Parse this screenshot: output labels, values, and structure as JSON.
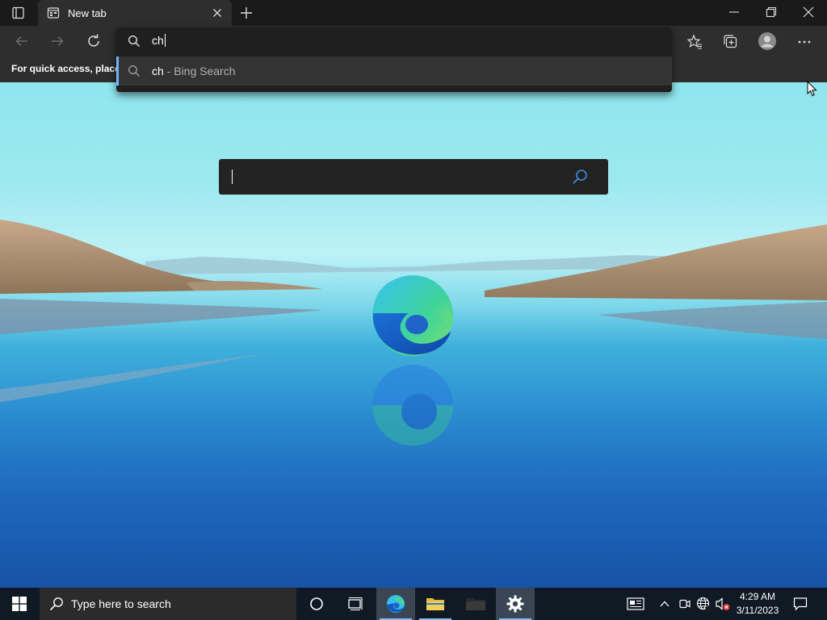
{
  "tab": {
    "title": "New tab"
  },
  "favorites_bar": {
    "text": "For quick access, place y"
  },
  "omnibox": {
    "value": "ch",
    "suggestion": {
      "query": "ch",
      "description": " - Bing Search"
    }
  },
  "taskbar": {
    "search_placeholder": "Type here to search",
    "time": "4:29 AM",
    "date": "3/11/2023"
  }
}
